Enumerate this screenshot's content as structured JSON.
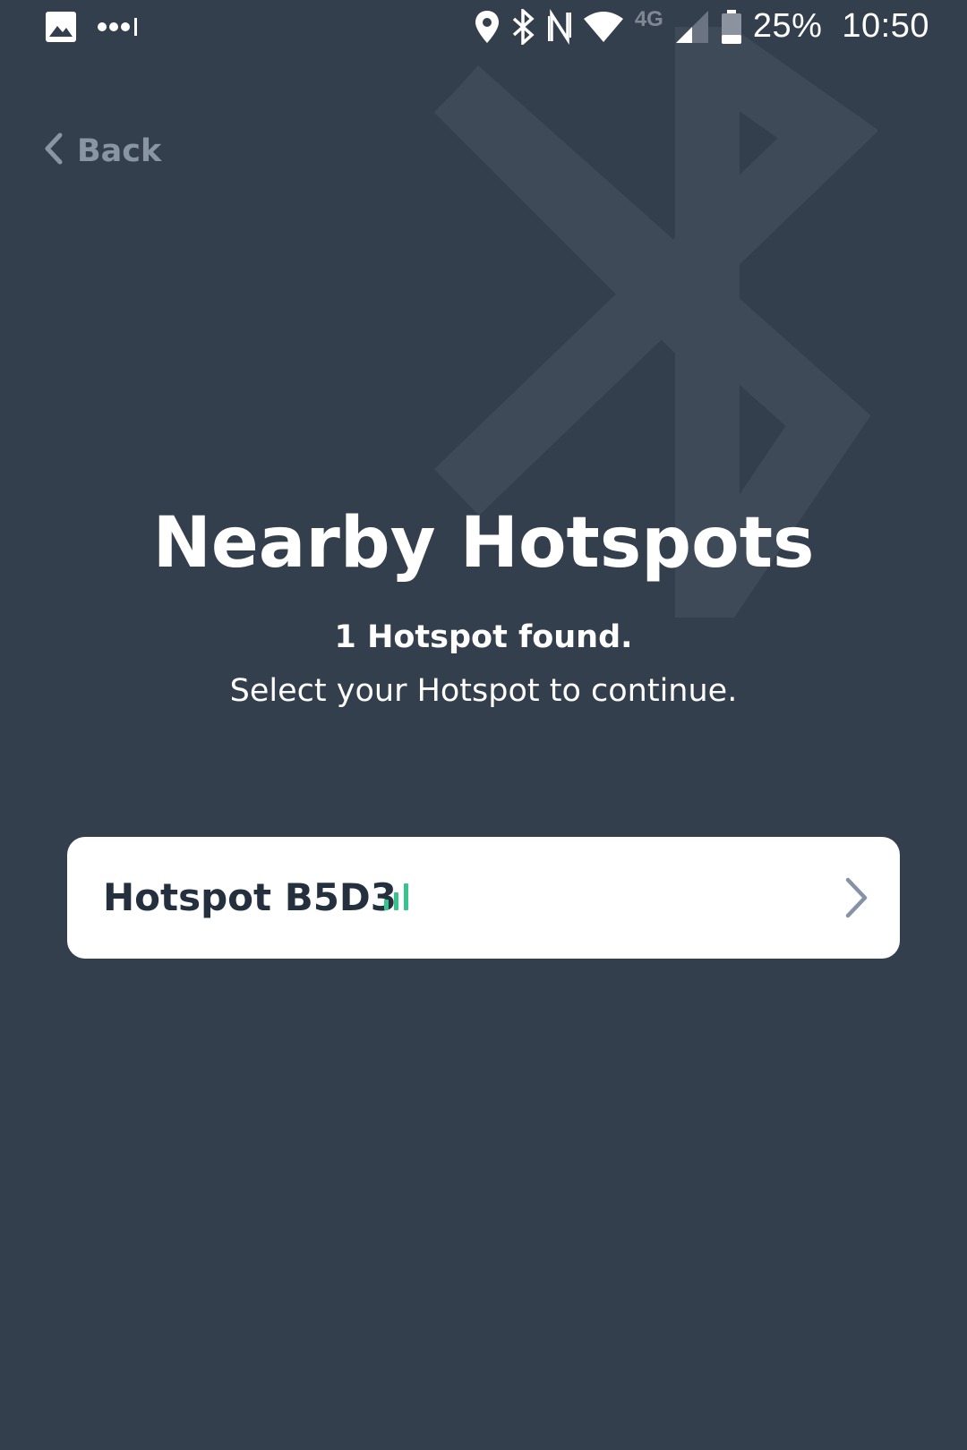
{
  "status_bar": {
    "icons_left": [
      "gallery-icon",
      "more-dots-icon"
    ],
    "icons_right": [
      "location-icon",
      "bluetooth-icon",
      "nfc-icon",
      "wifi-icon",
      "signal-icon",
      "battery-icon"
    ],
    "network_type": "4G",
    "battery": "25%",
    "time": "10:50"
  },
  "nav": {
    "back_label": "Back",
    "back_icon": "chevron-left-icon"
  },
  "header": {
    "title": "Nearby Hotspots",
    "subtitle_count": "1 Hotspot found.",
    "subtitle_instruction": "Select your Hotspot to continue."
  },
  "hotspots": [
    {
      "name": "Hotspot B5D3",
      "signal_icon": "signal-strength-icon",
      "chevron_icon": "chevron-right-icon"
    }
  ],
  "colors": {
    "background": "#343f4d",
    "watermark": "#3f4a59",
    "card": "#ffffff",
    "card_text": "#24303e",
    "signal": "#35c48c",
    "chevron": "#8593a5",
    "back_text": "#8a95a3"
  }
}
